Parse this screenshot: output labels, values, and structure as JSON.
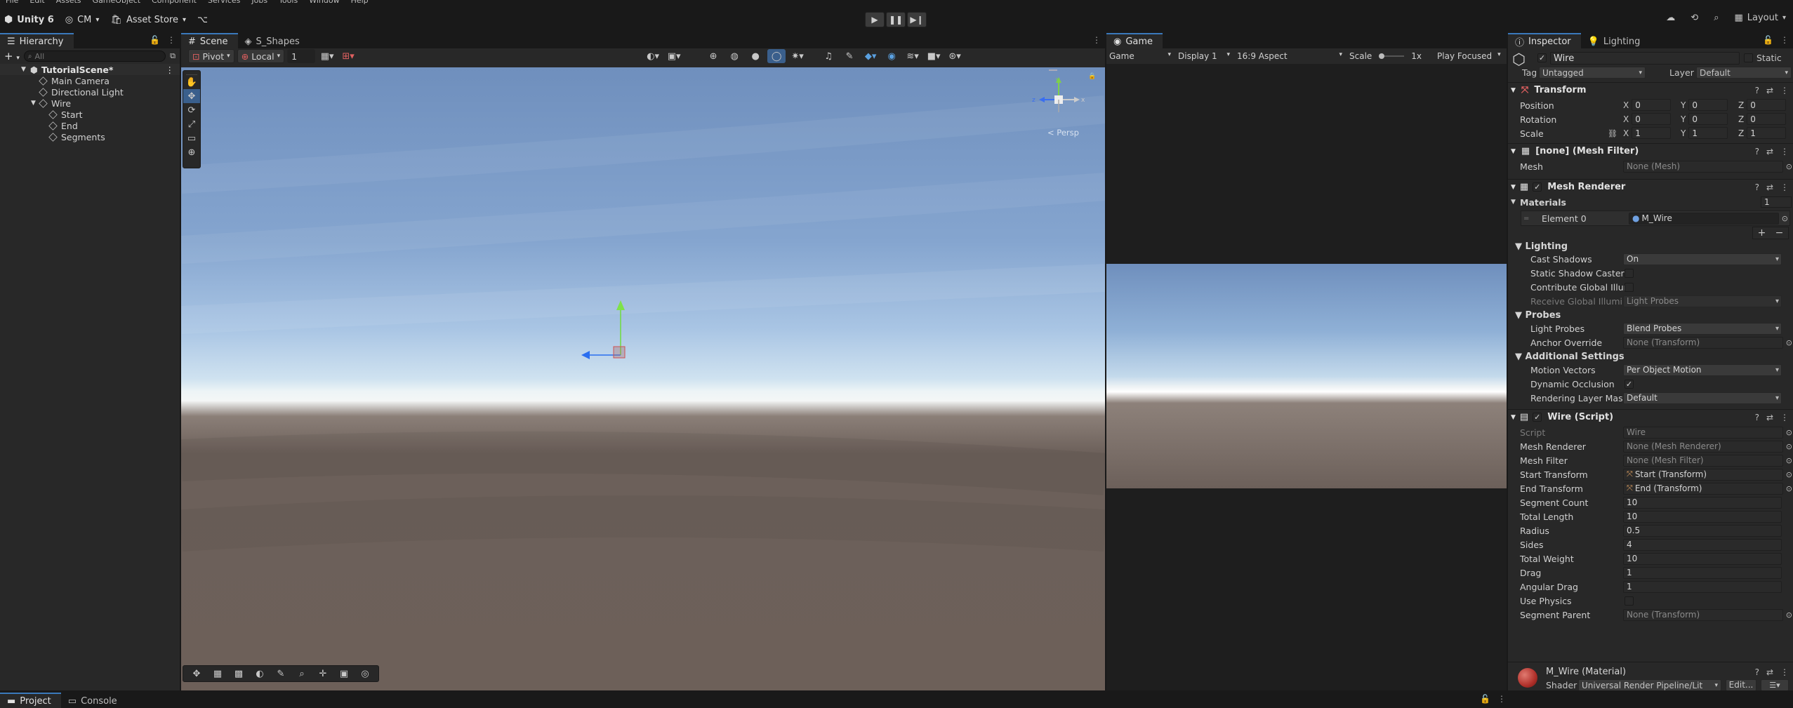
{
  "menu": [
    "File",
    "Edit",
    "Assets",
    "GameObject",
    "Component",
    "Services",
    "Jobs",
    "Tools",
    "Window",
    "Help"
  ],
  "toolbar": {
    "product": "Unity 6",
    "account": "CM",
    "asset_store": "Asset Store",
    "layout": "Layout"
  },
  "hierarchy": {
    "tab": "Hierarchy",
    "search_placeholder": "All",
    "scene": "TutorialScene*",
    "items": [
      {
        "label": "Main Camera",
        "depth": 1
      },
      {
        "label": "Directional Light",
        "depth": 1
      },
      {
        "label": "Wire",
        "depth": 1
      },
      {
        "label": "Start",
        "depth": 2
      },
      {
        "label": "End",
        "depth": 2
      },
      {
        "label": "Segments",
        "depth": 2
      }
    ]
  },
  "scene_view": {
    "tabs": [
      "Scene",
      "S_Shapes"
    ],
    "pivot": "Pivot",
    "space": "Local",
    "grid_size": "1",
    "gizmo_label": "< Persp",
    "gizmo_axes": {
      "y": "y",
      "x": "x",
      "z": "z"
    }
  },
  "game_view": {
    "tab": "Game",
    "mode": "Game",
    "display": "Display 1",
    "aspect": "16:9 Aspect",
    "scale_label": "Scale",
    "scale_value": "1x",
    "play_mode": "Play Focused"
  },
  "inspector": {
    "tabs": [
      "Inspector",
      "Lighting"
    ],
    "object_name": "Wire",
    "static_label": "Static",
    "tag_label": "Tag",
    "tag_value": "Untagged",
    "layer_label": "Layer",
    "layer_value": "Default",
    "transform": {
      "title": "Transform",
      "position_label": "Position",
      "position": [
        "0",
        "0",
        "0"
      ],
      "rotation_label": "Rotation",
      "rotation": [
        "0",
        "0",
        "0"
      ],
      "scale_label": "Scale",
      "scale": [
        "1",
        "1",
        "1"
      ]
    },
    "mesh_filter": {
      "title": "[none] (Mesh Filter)",
      "mesh_label": "Mesh",
      "mesh_value": "None (Mesh)"
    },
    "mesh_renderer": {
      "title": "Mesh Renderer",
      "materials_label": "Materials",
      "materials_count": "1",
      "element0_label": "Element 0",
      "element0_value": "M_Wire",
      "lighting_label": "Lighting",
      "cast_shadows_label": "Cast Shadows",
      "cast_shadows_value": "On",
      "static_shadow_label": "Static Shadow Caster",
      "contribute_gi_label": "Contribute Global Illum",
      "receive_gi_label": "Receive Global Illumina",
      "receive_gi_value": "Light Probes",
      "probes_label": "Probes",
      "light_probes_label": "Light Probes",
      "light_probes_value": "Blend Probes",
      "anchor_label": "Anchor Override",
      "anchor_value": "None (Transform)",
      "additional_label": "Additional Settings",
      "motion_label": "Motion Vectors",
      "motion_value": "Per Object Motion",
      "dynamic_occ_label": "Dynamic Occlusion",
      "render_layer_label": "Rendering Layer Mask",
      "render_layer_value": "Default"
    },
    "wire_script": {
      "title": "Wire (Script)",
      "fields": [
        {
          "label": "Script",
          "value": "Wire",
          "kind": "dim"
        },
        {
          "label": "Mesh Renderer",
          "value": "None (Mesh Renderer)",
          "kind": "obj"
        },
        {
          "label": "Mesh Filter",
          "value": "None (Mesh Filter)",
          "kind": "obj"
        },
        {
          "label": "Start Transform",
          "value": "Start (Transform)",
          "kind": "obj"
        },
        {
          "label": "End Transform",
          "value": "End (Transform)",
          "kind": "obj"
        },
        {
          "label": "Segment Count",
          "value": "10",
          "kind": "num"
        },
        {
          "label": "Total Length",
          "value": "10",
          "kind": "num"
        },
        {
          "label": "Radius",
          "value": "0.5",
          "kind": "num"
        },
        {
          "label": "Sides",
          "value": "4",
          "kind": "num"
        },
        {
          "label": "Total Weight",
          "value": "10",
          "kind": "num"
        },
        {
          "label": "Drag",
          "value": "1",
          "kind": "num"
        },
        {
          "label": "Angular Drag",
          "value": "1",
          "kind": "num"
        },
        {
          "label": "Use Physics",
          "value": "",
          "kind": "check"
        },
        {
          "label": "Segment Parent",
          "value": "None (Transform)",
          "kind": "obj"
        }
      ]
    },
    "material": {
      "title": "M_Wire (Material)",
      "shader_label": "Shader",
      "shader_value": "Universal Render Pipeline/Lit",
      "edit_label": "Edit..."
    }
  },
  "bottom_tabs": [
    "Project",
    "Console"
  ]
}
